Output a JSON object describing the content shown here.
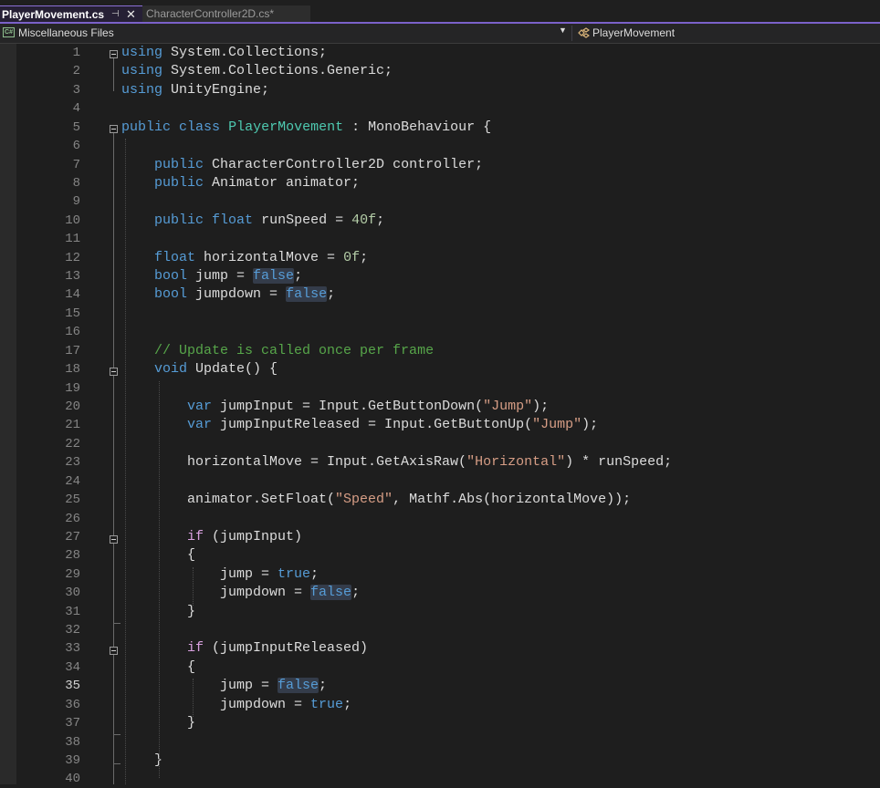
{
  "tabs": [
    {
      "label": "PlayerMovement.cs",
      "pin_icon": "pin-icon",
      "close_icon": "close-icon",
      "active": true
    },
    {
      "label": "CharacterController2D.cs*",
      "active": false
    }
  ],
  "nav": {
    "project_label": "Miscellaneous Files",
    "project_icon": "csharp-project-icon",
    "member_label": "PlayerMovement",
    "member_icon": "class-icon",
    "dropdown_icon": "dropdown-arrow-icon"
  },
  "editor": {
    "current_line": 35,
    "lines": [
      {
        "n": "1",
        "t": [
          {
            "c": "kw",
            "s": "using"
          },
          {
            "c": "id",
            "s": " System.Collections;"
          }
        ]
      },
      {
        "n": "2",
        "t": [
          {
            "c": "kw",
            "s": "using"
          },
          {
            "c": "id",
            "s": " System.Collections.Generic;"
          }
        ]
      },
      {
        "n": "3",
        "t": [
          {
            "c": "kw",
            "s": "using"
          },
          {
            "c": "id",
            "s": " UnityEngine;"
          }
        ]
      },
      {
        "n": "4",
        "t": []
      },
      {
        "n": "5",
        "t": [
          {
            "c": "kw",
            "s": "public"
          },
          {
            "c": "id",
            "s": " "
          },
          {
            "c": "kw",
            "s": "class"
          },
          {
            "c": "id",
            "s": " "
          },
          {
            "c": "typ",
            "s": "PlayerMovement"
          },
          {
            "c": "id",
            "s": " : MonoBehaviour {"
          }
        ]
      },
      {
        "n": "6",
        "t": []
      },
      {
        "n": "7",
        "t": [
          {
            "c": "id",
            "s": "    "
          },
          {
            "c": "kw",
            "s": "public"
          },
          {
            "c": "id",
            "s": " CharacterController2D controller;"
          }
        ]
      },
      {
        "n": "8",
        "t": [
          {
            "c": "id",
            "s": "    "
          },
          {
            "c": "kw",
            "s": "public"
          },
          {
            "c": "id",
            "s": " Animator animator;"
          }
        ]
      },
      {
        "n": "9",
        "t": []
      },
      {
        "n": "10",
        "t": [
          {
            "c": "id",
            "s": "    "
          },
          {
            "c": "kw",
            "s": "public"
          },
          {
            "c": "id",
            "s": " "
          },
          {
            "c": "kw",
            "s": "float"
          },
          {
            "c": "id",
            "s": " runSpeed = "
          },
          {
            "c": "num",
            "s": "40f"
          },
          {
            "c": "id",
            "s": ";"
          }
        ]
      },
      {
        "n": "11",
        "t": []
      },
      {
        "n": "12",
        "t": [
          {
            "c": "id",
            "s": "    "
          },
          {
            "c": "kw",
            "s": "float"
          },
          {
            "c": "id",
            "s": " horizontalMove = "
          },
          {
            "c": "num",
            "s": "0f"
          },
          {
            "c": "id",
            "s": ";"
          }
        ]
      },
      {
        "n": "13",
        "t": [
          {
            "c": "id",
            "s": "    "
          },
          {
            "c": "kw",
            "s": "bool"
          },
          {
            "c": "id",
            "s": " jump = "
          },
          {
            "c": "kw hl",
            "s": "false"
          },
          {
            "c": "id",
            "s": ";"
          }
        ]
      },
      {
        "n": "14",
        "t": [
          {
            "c": "id",
            "s": "    "
          },
          {
            "c": "kw",
            "s": "bool"
          },
          {
            "c": "id",
            "s": " jumpdown = "
          },
          {
            "c": "kw hl",
            "s": "false"
          },
          {
            "c": "id",
            "s": ";"
          }
        ]
      },
      {
        "n": "15",
        "t": []
      },
      {
        "n": "16",
        "t": []
      },
      {
        "n": "17",
        "t": [
          {
            "c": "id",
            "s": "    "
          },
          {
            "c": "cmt",
            "s": "// Update is called once per frame"
          }
        ]
      },
      {
        "n": "18",
        "t": [
          {
            "c": "id",
            "s": "    "
          },
          {
            "c": "kw",
            "s": "void"
          },
          {
            "c": "id",
            "s": " Update() {"
          }
        ]
      },
      {
        "n": "19",
        "t": []
      },
      {
        "n": "20",
        "t": [
          {
            "c": "id",
            "s": "        "
          },
          {
            "c": "kw",
            "s": "var"
          },
          {
            "c": "id",
            "s": " jumpInput = Input.GetButtonDown("
          },
          {
            "c": "str",
            "s": "\"Jump\""
          },
          {
            "c": "id",
            "s": ");"
          }
        ]
      },
      {
        "n": "21",
        "t": [
          {
            "c": "id",
            "s": "        "
          },
          {
            "c": "kw",
            "s": "var"
          },
          {
            "c": "id",
            "s": " jumpInputReleased = Input.GetButtonUp("
          },
          {
            "c": "str",
            "s": "\"Jump\""
          },
          {
            "c": "id",
            "s": ");"
          }
        ]
      },
      {
        "n": "22",
        "t": []
      },
      {
        "n": "23",
        "t": [
          {
            "c": "id",
            "s": "        horizontalMove = Input.GetAxisRaw("
          },
          {
            "c": "str",
            "s": "\"Horizontal\""
          },
          {
            "c": "id",
            "s": ") * runSpeed;"
          }
        ]
      },
      {
        "n": "24",
        "t": []
      },
      {
        "n": "25",
        "t": [
          {
            "c": "id",
            "s": "        animator.SetFloat("
          },
          {
            "c": "str",
            "s": "\"Speed\""
          },
          {
            "c": "id",
            "s": ", Mathf.Abs(horizontalMove));"
          }
        ]
      },
      {
        "n": "26",
        "t": []
      },
      {
        "n": "27",
        "t": [
          {
            "c": "id",
            "s": "        "
          },
          {
            "c": "ctl",
            "s": "if"
          },
          {
            "c": "id",
            "s": " (jumpInput)"
          }
        ]
      },
      {
        "n": "28",
        "t": [
          {
            "c": "id",
            "s": "        {"
          }
        ]
      },
      {
        "n": "29",
        "t": [
          {
            "c": "id",
            "s": "            jump = "
          },
          {
            "c": "kw",
            "s": "true"
          },
          {
            "c": "id",
            "s": ";"
          }
        ]
      },
      {
        "n": "30",
        "t": [
          {
            "c": "id",
            "s": "            jumpdown = "
          },
          {
            "c": "kw hl",
            "s": "false"
          },
          {
            "c": "id",
            "s": ";"
          }
        ]
      },
      {
        "n": "31",
        "t": [
          {
            "c": "id",
            "s": "        }"
          }
        ]
      },
      {
        "n": "32",
        "t": []
      },
      {
        "n": "33",
        "t": [
          {
            "c": "id",
            "s": "        "
          },
          {
            "c": "ctl",
            "s": "if"
          },
          {
            "c": "id",
            "s": " (jumpInputReleased)"
          }
        ]
      },
      {
        "n": "34",
        "t": [
          {
            "c": "id",
            "s": "        {"
          }
        ]
      },
      {
        "n": "35",
        "t": [
          {
            "c": "id",
            "s": "            jump = "
          },
          {
            "c": "kw hl",
            "s": "false"
          },
          {
            "c": "id",
            "s": ";"
          }
        ]
      },
      {
        "n": "36",
        "t": [
          {
            "c": "id",
            "s": "            jumpdown = "
          },
          {
            "c": "kw",
            "s": "true"
          },
          {
            "c": "id",
            "s": ";"
          }
        ]
      },
      {
        "n": "37",
        "t": [
          {
            "c": "id",
            "s": "        }"
          }
        ]
      },
      {
        "n": "38",
        "t": []
      },
      {
        "n": "39",
        "t": [
          {
            "c": "id",
            "s": "    }"
          }
        ]
      },
      {
        "n": "40",
        "t": []
      }
    ]
  },
  "colors": {
    "keyword": "#569cd6",
    "control": "#d8a0df",
    "type": "#4ec9b0",
    "number": "#b5cea8",
    "string": "#d69d85",
    "comment": "#57a64a",
    "active_tab_accent": "#7b61c9"
  }
}
